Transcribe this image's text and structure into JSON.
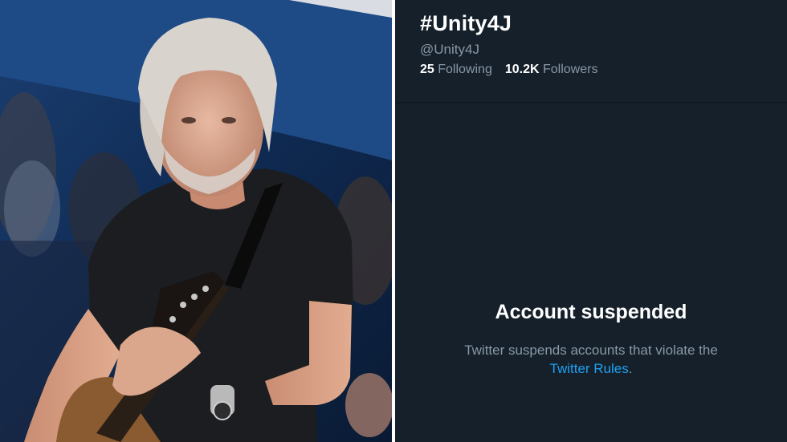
{
  "profile": {
    "name": "#Unity4J",
    "handle": "@Unity4J",
    "following_count": "25",
    "following_label": "Following",
    "followers_count": "10.2K",
    "followers_label": "Followers"
  },
  "suspension": {
    "title": "Account suspended",
    "message": "Twitter suspends accounts that violate the",
    "link_text": "Twitter Rules",
    "suffix": "."
  },
  "colors": {
    "twitter_bg": "#15202b",
    "muted_text": "#8899a6",
    "link": "#1da1f2"
  }
}
